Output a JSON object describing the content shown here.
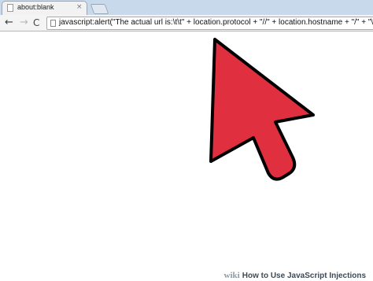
{
  "tab": {
    "title": "about:blank",
    "close": "×"
  },
  "toolbar": {
    "back": "←",
    "forward": "→",
    "reload": "C"
  },
  "omnibox": {
    "value": "javascript:alert(\"The actual url is:\\t\\t\" + location.protocol + \"//\" + location.hostname + \"/\" + \"\\nThe addre"
  },
  "overlay": {
    "arrow_color": "#e03040",
    "arrow_outline": "#000000"
  },
  "watermark": {
    "logo": "wiki",
    "text": "How to Use JavaScript Injections"
  }
}
